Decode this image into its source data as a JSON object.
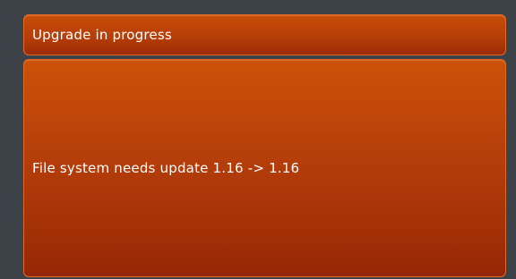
{
  "header": {
    "title": "Upgrade in progress"
  },
  "content": {
    "message": "File system needs update 1.16 -> 1.16"
  },
  "colors": {
    "background": "#3c4248",
    "panel_top": "#cc5208",
    "panel_bottom": "#952706",
    "text": "#ffffff"
  }
}
